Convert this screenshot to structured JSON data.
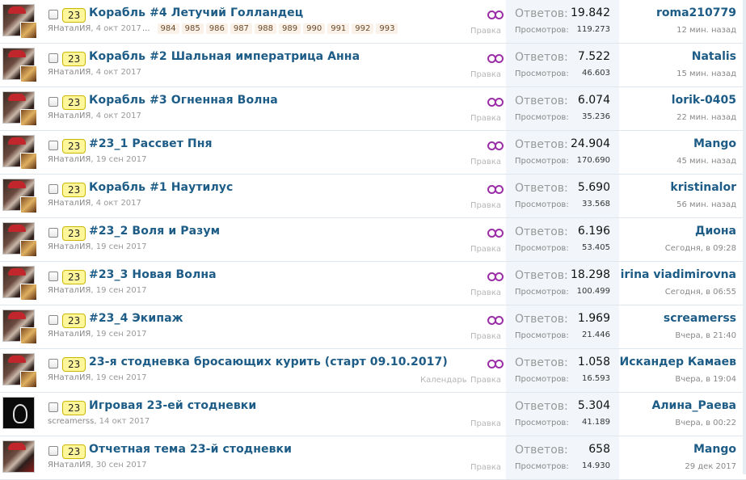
{
  "labels": {
    "replies": "Ответов:",
    "views": "Просмотров:",
    "edit": "Правка",
    "calendar": "Календарь",
    "dots": "..."
  },
  "threads": [
    {
      "prefix": "23",
      "title": "Корабль #4 Летучий Голландец",
      "author": "ЯНаталИЯ",
      "date": "4 окт 2017",
      "pages": [
        "984",
        "985",
        "986",
        "987",
        "988",
        "989",
        "990",
        "991",
        "992",
        "993"
      ],
      "replies": "19.842",
      "views": "119.273",
      "last_user": "roma210779",
      "last_time": "12 мин. назад",
      "avatar": "santa"
    },
    {
      "prefix": "23",
      "title": "Корабль #2 Шальная императрица Анна",
      "author": "ЯНаталИЯ",
      "date": "4 окт 2017",
      "replies": "7.522",
      "views": "46.603",
      "last_user": "Natalis",
      "last_time": "15 мин. назад",
      "avatar": "santa"
    },
    {
      "prefix": "23",
      "title": "Корабль #3 Огненная Волна",
      "author": "ЯНаталИЯ",
      "date": "4 окт 2017",
      "replies": "6.074",
      "views": "35.236",
      "last_user": "lorik-0405",
      "last_time": "22 мин. назад",
      "avatar": "santa"
    },
    {
      "prefix": "23",
      "title": "#23_1 Рассвет Пня",
      "author": "ЯНаталИЯ",
      "date": "19 сен 2017",
      "replies": "24.904",
      "views": "170.690",
      "last_user": "Mango",
      "last_time": "45 мин. назад",
      "avatar": "santa"
    },
    {
      "prefix": "23",
      "title": "Корабль #1 Наутилус",
      "author": "ЯНаталИЯ",
      "date": "4 окт 2017",
      "replies": "5.690",
      "views": "33.568",
      "last_user": "kristinalor",
      "last_time": "56 мин. назад",
      "avatar": "santa"
    },
    {
      "prefix": "23",
      "title": "#23_2 Воля и Разум",
      "author": "ЯНаталИЯ",
      "date": "19 сен 2017",
      "replies": "6.196",
      "views": "53.405",
      "last_user": "Диона",
      "last_time": "Сегодня, в 09:28",
      "avatar": "santa"
    },
    {
      "prefix": "23",
      "title": "#23_3 Новая Волна",
      "author": "ЯНаталИЯ",
      "date": "19 сен 2017",
      "replies": "18.298",
      "views": "100.499",
      "last_user": "irina viadimirovna",
      "last_time": "Сегодня, в 06:55",
      "avatar": "santa"
    },
    {
      "prefix": "23",
      "title": "#23_4 Экипаж",
      "author": "ЯНаталИЯ",
      "date": "19 сен 2017",
      "replies": "1.969",
      "views": "21.446",
      "last_user": "screamerss",
      "last_time": "Вчера, в 21:40",
      "avatar": "santa"
    },
    {
      "prefix": "23",
      "title": "23-я стодневка бросающих курить (старт 09.10.2017)",
      "author": "ЯНаталИЯ",
      "date": "19 сен 2017",
      "replies": "1.058",
      "views": "16.593",
      "last_user": "Искандер Камаев",
      "last_time": "Вчера, в 19:04",
      "avatar": "santa",
      "calendar": true
    },
    {
      "prefix": "23",
      "title": "Игровая 23-ей стодневки",
      "author": "screamerss",
      "date": "14 окт 2017",
      "replies": "5.304",
      "views": "41.189",
      "last_user": "Алина_Раева",
      "last_time": "Вчера, в 00:22",
      "avatar": "dark",
      "no_watch": true
    },
    {
      "prefix": "23",
      "title": "Отчетная тема 23-й стодневки",
      "author": "ЯНаталИЯ",
      "date": "30 сен 2017",
      "replies": "658",
      "views": "14.930",
      "last_user": "Mango",
      "last_time": "29 дек 2017",
      "avatar": "santa",
      "no_watch": true
    }
  ]
}
